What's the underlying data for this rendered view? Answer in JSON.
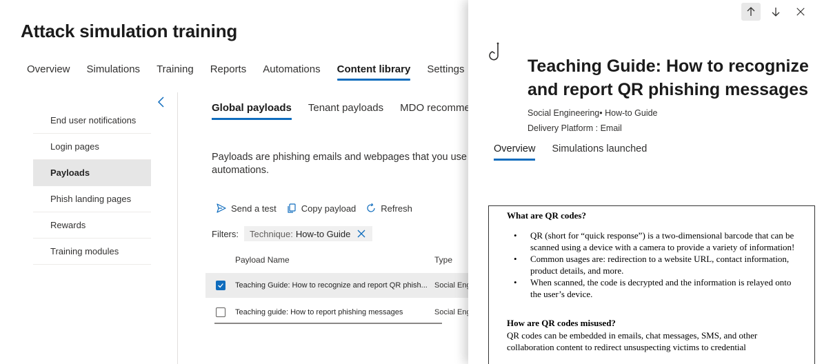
{
  "page": {
    "title": "Attack simulation training"
  },
  "main_tabs": [
    {
      "label": "Overview"
    },
    {
      "label": "Simulations"
    },
    {
      "label": "Training"
    },
    {
      "label": "Reports"
    },
    {
      "label": "Automations"
    },
    {
      "label": "Content library",
      "active": true
    },
    {
      "label": "Settings"
    }
  ],
  "sidebar": {
    "items": [
      {
        "label": "End user notifications"
      },
      {
        "label": "Login pages"
      },
      {
        "label": "Payloads",
        "active": true
      },
      {
        "label": "Phish landing pages"
      },
      {
        "label": "Rewards"
      },
      {
        "label": "Training modules"
      }
    ]
  },
  "sub_tabs": [
    {
      "label": "Global payloads",
      "active": true
    },
    {
      "label": "Tenant payloads"
    },
    {
      "label": "MDO recommend"
    }
  ],
  "description": "Payloads are phishing emails and webpages that you use t automatically with automations.",
  "toolbar": {
    "send_test": "Send a test",
    "copy_payload": "Copy payload",
    "refresh": "Refresh"
  },
  "filters": {
    "label": "Filters:",
    "chip_label": "Technique:",
    "chip_value": "How-to Guide"
  },
  "table": {
    "headers": {
      "name": "Payload Name",
      "type": "Type"
    },
    "rows": [
      {
        "name": "Teaching Guide: How to recognize and report QR phish...",
        "type": "Social Eng",
        "selected": true
      },
      {
        "name": "Teaching guide: How to report phishing messages",
        "type": "Social Eng",
        "selected": false
      }
    ]
  },
  "panel": {
    "title": "Teaching Guide: How to recognize and report QR phishing messages",
    "meta_category": "Social Engineering• How-to Guide",
    "meta_platform": "Delivery Platform : Email",
    "tabs": [
      {
        "label": "Overview",
        "active": true
      },
      {
        "label": "Simulations launched"
      }
    ],
    "preview": {
      "heading1": "What are QR codes?",
      "bullets": [
        "QR (short for “quick response”) is a two-dimensional barcode that can be scanned using a device with a camera to provide a variety of information!",
        "Common usages are: redirection to a website URL, contact information, product details, and more.",
        "When scanned, the code is decrypted and the information is relayed onto the user’s device."
      ],
      "heading2": "How are QR codes misused?",
      "para": "QR codes can be embedded in emails, chat messages, SMS, and other collaboration content to redirect unsuspecting victims to credential"
    }
  },
  "colors": {
    "accent": "#0f6cbd",
    "selected_row": "#ececec",
    "active_nav": "#e6e6e6"
  }
}
